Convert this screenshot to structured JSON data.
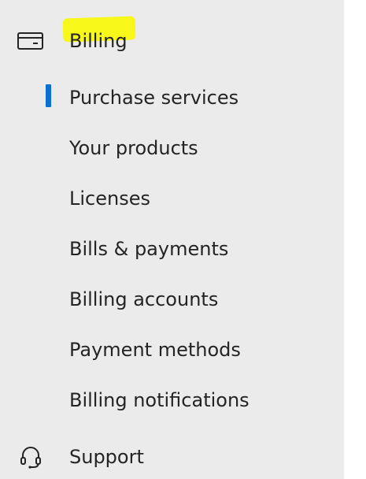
{
  "nav": {
    "billing": {
      "label": "Billing",
      "icon": "credit-card-icon",
      "highlight_color": "#f7f719"
    },
    "items": [
      {
        "label": "Purchase services",
        "selected": true
      },
      {
        "label": "Your products",
        "selected": false
      },
      {
        "label": "Licenses",
        "selected": false
      },
      {
        "label": "Bills & payments",
        "selected": false
      },
      {
        "label": "Billing accounts",
        "selected": false
      },
      {
        "label": "Payment methods",
        "selected": false
      },
      {
        "label": "Billing notifications",
        "selected": false
      }
    ],
    "support": {
      "label": "Support",
      "icon": "headset-icon"
    }
  },
  "colors": {
    "panel_background": "#ebebeb",
    "selected_indicator": "#0a6fd1",
    "text": "#242424"
  }
}
